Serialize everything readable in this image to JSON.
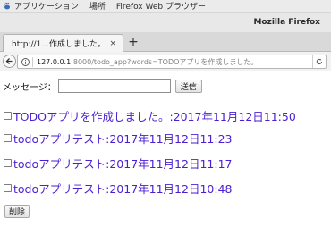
{
  "system_bar": {
    "menus": [
      "アプリケーション",
      "場所",
      "Firefox Web ブラウザー"
    ]
  },
  "window": {
    "title": "Mozilla Firefox"
  },
  "tab": {
    "title": "http://1...作成しました。",
    "close_glyph": "×",
    "new_tab_glyph": "+"
  },
  "navbar": {
    "url_host": "127.0.0.1",
    "url_rest": ":8000/todo_app?words=TODOアプリを作成しました。"
  },
  "form": {
    "label": "メッセージ：",
    "input_value": "",
    "submit_label": "送信"
  },
  "todos": [
    {
      "text": "TODOアプリを作成しました。:2017年11月12日11:50",
      "checked": false
    },
    {
      "text": "todoアプリテスト:2017年11月12日11:23",
      "checked": false
    },
    {
      "text": "todoアプリテスト:2017年11月12日11:17",
      "checked": false
    },
    {
      "text": "todoアプリテスト:2017年11月12日10:48",
      "checked": false
    }
  ],
  "delete_label": "削除",
  "colors": {
    "todo_text": "#4a1fd0",
    "panel_bg": "#ebebeb"
  }
}
